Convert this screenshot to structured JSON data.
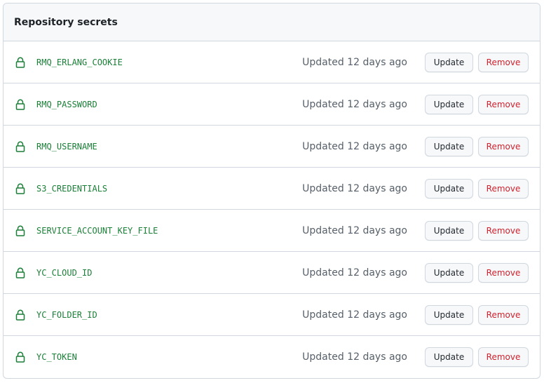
{
  "panel": {
    "title": "Repository secrets"
  },
  "colors": {
    "accent_green": "#1a7f37",
    "danger_red": "#cf222e",
    "muted_text": "#57606a",
    "border": "#d0d7de"
  },
  "secrets": [
    {
      "name": "RMQ_ERLANG_COOKIE",
      "updated": "Updated 12 days ago",
      "update_label": "Update",
      "remove_label": "Remove",
      "icon": "lock-icon"
    },
    {
      "name": "RMQ_PASSWORD",
      "updated": "Updated 12 days ago",
      "update_label": "Update",
      "remove_label": "Remove",
      "icon": "lock-icon"
    },
    {
      "name": "RMQ_USERNAME",
      "updated": "Updated 12 days ago",
      "update_label": "Update",
      "remove_label": "Remove",
      "icon": "lock-icon"
    },
    {
      "name": "S3_CREDENTIALS",
      "updated": "Updated 12 days ago",
      "update_label": "Update",
      "remove_label": "Remove",
      "icon": "lock-icon"
    },
    {
      "name": "SERVICE_ACCOUNT_KEY_FILE",
      "updated": "Updated 12 days ago",
      "update_label": "Update",
      "remove_label": "Remove",
      "icon": "lock-icon"
    },
    {
      "name": "YC_CLOUD_ID",
      "updated": "Updated 12 days ago",
      "update_label": "Update",
      "remove_label": "Remove",
      "icon": "lock-icon"
    },
    {
      "name": "YC_FOLDER_ID",
      "updated": "Updated 12 days ago",
      "update_label": "Update",
      "remove_label": "Remove",
      "icon": "lock-icon"
    },
    {
      "name": "YC_TOKEN",
      "updated": "Updated 12 days ago",
      "update_label": "Update",
      "remove_label": "Remove",
      "icon": "lock-icon"
    }
  ]
}
